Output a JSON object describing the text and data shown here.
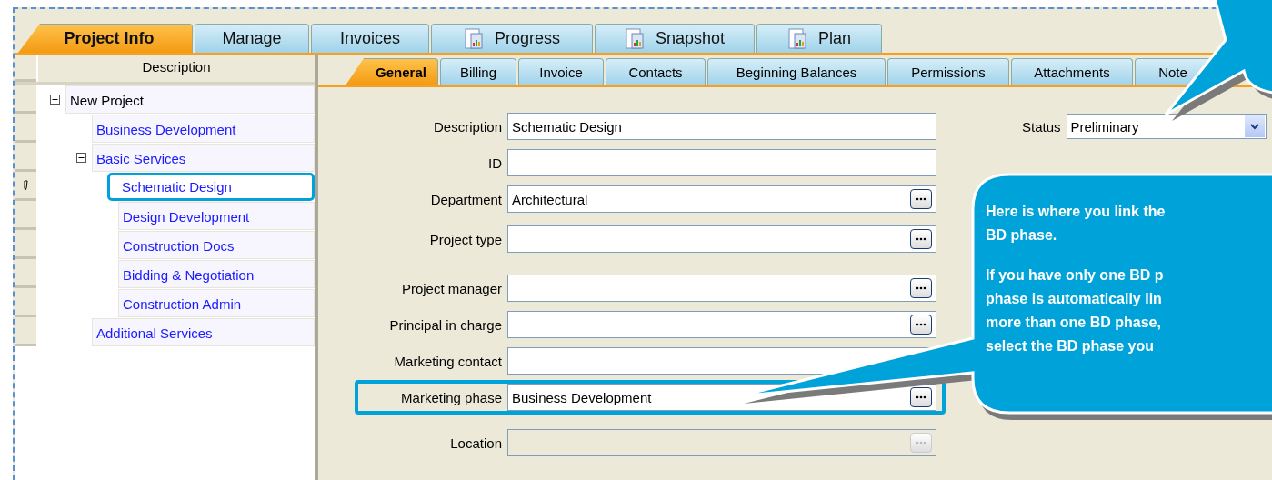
{
  "main_tabs": [
    {
      "label": "Project Info",
      "selected": true,
      "kind": "plain"
    },
    {
      "label": "Manage",
      "selected": false,
      "kind": "plain"
    },
    {
      "label": "Invoices",
      "selected": false,
      "kind": "plain"
    },
    {
      "label": "Progress",
      "selected": false,
      "kind": "report"
    },
    {
      "label": "Snapshot",
      "selected": false,
      "kind": "report"
    },
    {
      "label": "Plan",
      "selected": false,
      "kind": "report"
    }
  ],
  "tree": {
    "header": "Description",
    "items": [
      {
        "label": "New Project",
        "selected": false,
        "expanded": true,
        "children": [
          {
            "label": "Business Development",
            "selected": false
          },
          {
            "label": "Basic Services",
            "selected": false,
            "expanded": true,
            "children": [
              {
                "label": "Schematic Design",
                "selected": true
              },
              {
                "label": "Design Development",
                "selected": false
              },
              {
                "label": "Construction Docs",
                "selected": false
              },
              {
                "label": "Bidding & Negotiation",
                "selected": false
              },
              {
                "label": "Construction Admin",
                "selected": false
              }
            ]
          },
          {
            "label": "Additional Services",
            "selected": false
          }
        ]
      }
    ]
  },
  "sub_tabs": [
    {
      "label": "General",
      "selected": true
    },
    {
      "label": "Billing",
      "selected": false
    },
    {
      "label": "Invoice",
      "selected": false
    },
    {
      "label": "Contacts",
      "selected": false
    },
    {
      "label": "Beginning Balances",
      "selected": false
    },
    {
      "label": "Permissions",
      "selected": false
    },
    {
      "label": "Attachments",
      "selected": false
    },
    {
      "label": "Note",
      "selected": false
    }
  ],
  "form": {
    "groups": [
      [
        {
          "label": "Description",
          "value": "Schematic Design",
          "kind": "text",
          "disabled": false,
          "highlighted": false
        },
        {
          "label": "ID",
          "kind": "text",
          "disabled": false,
          "highlighted": false
        },
        {
          "label": "Department",
          "value": "Architectural",
          "kind": "lookup",
          "disabled": false,
          "highlighted": false
        },
        {
          "label": "Project type",
          "kind": "lookup",
          "disabled": false,
          "highlighted": false
        }
      ],
      [
        {
          "label": "Project manager",
          "kind": "lookup",
          "disabled": false,
          "highlighted": false
        },
        {
          "label": "Principal in charge",
          "kind": "lookup",
          "disabled": false,
          "highlighted": false
        },
        {
          "label": "Marketing contact",
          "kind": "text",
          "disabled": false,
          "highlighted": false
        },
        {
          "label": "Marketing phase",
          "value": "Business Development",
          "kind": "lookup",
          "disabled": false,
          "highlighted": true
        }
      ],
      [
        {
          "label": "Location",
          "kind": "lookup",
          "disabled": true,
          "highlighted": false
        }
      ]
    ],
    "status": {
      "label": "Status",
      "value": "Preliminary"
    }
  },
  "callout": {
    "lines": [
      "Here is where you link the",
      "BD phase.",
      "If you have only one BD p",
      "phase is automatically lin",
      "more than one BD phase,",
      "select the BD phase you"
    ]
  }
}
